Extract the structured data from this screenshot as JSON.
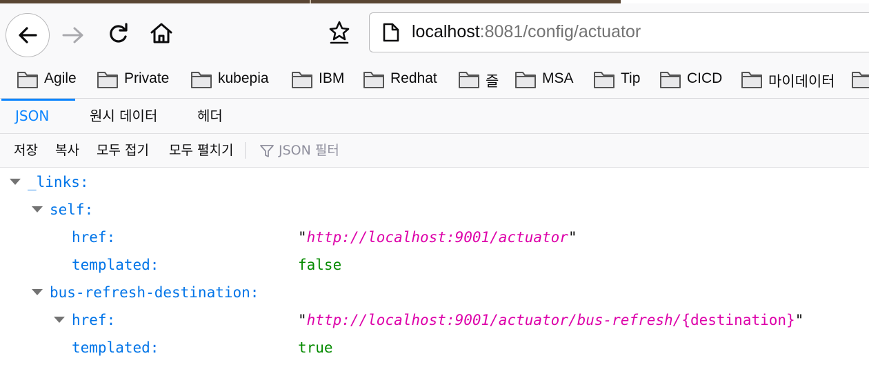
{
  "browser": {
    "url_host": "localhost",
    "url_path": ":8081/config/actuator",
    "icons": [
      "back-arrow-icon",
      "forward-arrow-icon",
      "reload-icon",
      "home-icon",
      "bookmark-star-icon",
      "page-icon"
    ]
  },
  "bookmarks": [
    {
      "label": "Agile"
    },
    {
      "label": "Private"
    },
    {
      "label": "kubepia"
    },
    {
      "label": "IBM"
    },
    {
      "label": "Redhat"
    },
    {
      "label": "즐"
    },
    {
      "label": "MSA"
    },
    {
      "label": "Tip"
    },
    {
      "label": "CICD"
    },
    {
      "label": "마이데이터"
    }
  ],
  "viewer": {
    "tabs": [
      {
        "label": "JSON",
        "active": true
      },
      {
        "label": "원시 데이터",
        "active": false
      },
      {
        "label": "헤더",
        "active": false
      }
    ],
    "toolbar": {
      "save": "저장",
      "copy": "복사",
      "collapse_all": "모두 접기",
      "expand_all": "모두 펼치기",
      "filter_placeholder": "JSON 필터"
    }
  },
  "json_tree": {
    "links_key": "_links:",
    "self_key": "self:",
    "self_href_key": "href:",
    "self_href_value": "http://localhost:9001/actuator",
    "self_templated_key": "templated:",
    "self_templated_value": "false",
    "bus_key": "bus-refresh-destination:",
    "bus_href_key": "href:",
    "bus_href_value": "http://localhost:9001/actuator/bus-refresh/",
    "bus_href_value_tail": "{destination}",
    "bus_templated_key": "templated:",
    "bus_templated_value": "true"
  },
  "colors": {
    "accent": "#0a84ff",
    "json_key": "#0074e8",
    "json_string": "#dd00a9",
    "json_bool": "#058b00"
  }
}
